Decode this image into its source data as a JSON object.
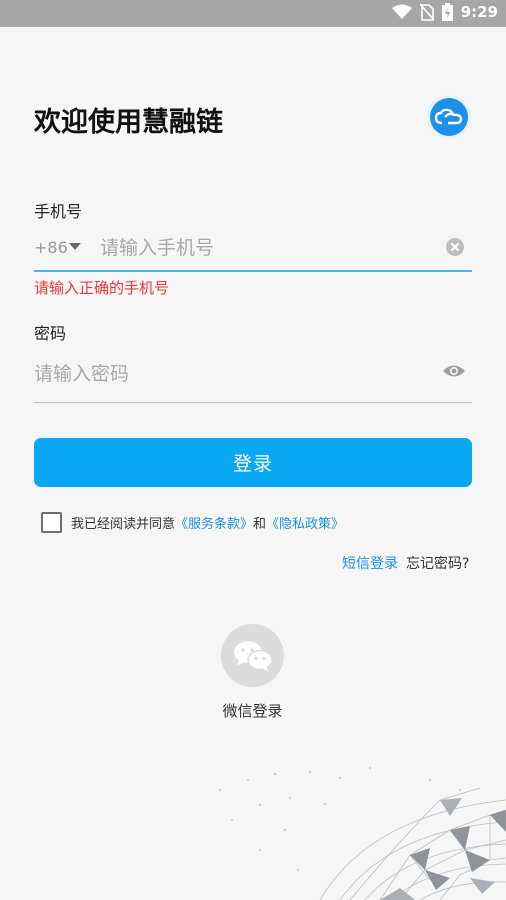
{
  "status_bar": {
    "time": "9:29"
  },
  "header": {
    "title": "欢迎使用慧融链",
    "logo_icon": "cloud-link-logo-icon"
  },
  "phone": {
    "label": "手机号",
    "country_code": "+86",
    "placeholder": "请输入手机号",
    "value": "",
    "error": "请输入正确的手机号"
  },
  "password": {
    "label": "密码",
    "placeholder": "请输入密码",
    "value": ""
  },
  "login_button": {
    "label": "登录"
  },
  "agreement": {
    "text": "我已经阅读并同意",
    "terms_link": "《服务条款》",
    "and": "和",
    "privacy_link": "《隐私政策》",
    "checked": false
  },
  "links": {
    "sms_login": "短信登录",
    "forgot_password": "忘记密码?"
  },
  "wechat": {
    "label": "微信登录"
  },
  "colors": {
    "accent": "#0aa7f3",
    "link": "#1e90e6",
    "error": "#e8383d"
  }
}
